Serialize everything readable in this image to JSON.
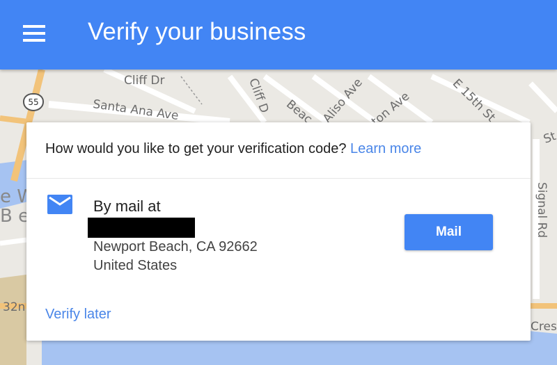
{
  "appbar": {
    "title": "Verify your business",
    "menu_icon": "hamburger-menu-icon",
    "color": "#4285f4"
  },
  "map": {
    "labels": {
      "cliff_dr": "Cliff Dr",
      "santa_ana_ave": "Santa Ana Ave",
      "cliff_dr_vertical": "Cliff D",
      "beac": "Beac",
      "aliso_ave": "Aliso Ave",
      "ton_ave": "ton Ave",
      "e_15th_st": "E 15th St",
      "st": "St",
      "signal_rd": "Signal Rd",
      "e_w": "e W",
      "b_e": "B e",
      "n32": "32n",
      "crest": "Crest"
    },
    "highway_shield": "55"
  },
  "card": {
    "question": "How would you like to get your verification code?",
    "learn_more": "Learn more",
    "option": {
      "icon": "mail-envelope-icon",
      "title": "By mail at",
      "address_line1": "Newport Beach, CA 92662",
      "address_line2": "United States",
      "button_label": "Mail"
    },
    "verify_later": "Verify later",
    "accent_color": "#4a86e8"
  }
}
